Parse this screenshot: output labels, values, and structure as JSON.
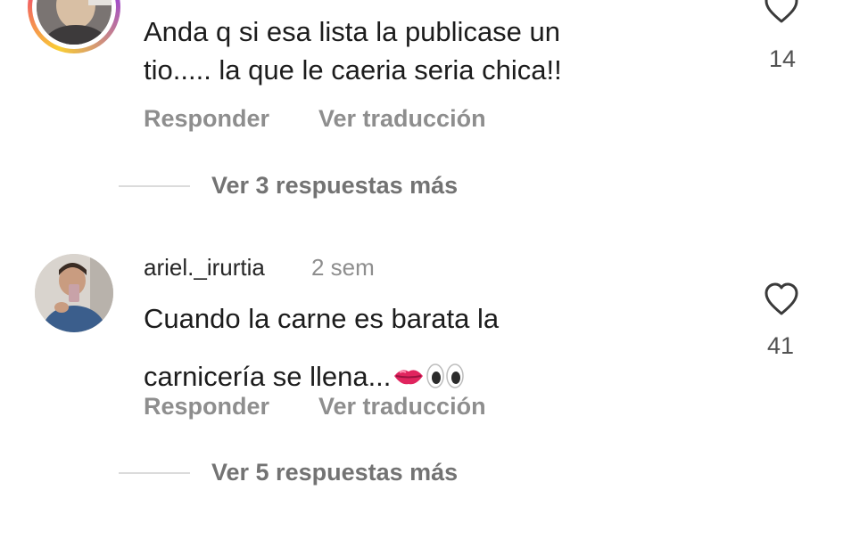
{
  "comments": [
    {
      "username": "",
      "timestamp": "",
      "text_line1": "Anda q si esa lista la publicase un",
      "text_line2": "tio..... la que le caeria seria chica!!",
      "likes": "14",
      "reply_label": "Responder",
      "translate_label": "Ver traducción",
      "replies_label": "Ver 3 respuestas más"
    },
    {
      "username": "ariel._irurtia",
      "timestamp": "2 sem",
      "text_line1": "Cuando la carne es barata la",
      "text_line2": "carnicería se llena...",
      "emojis": "👄👀",
      "likes": "41",
      "reply_label": "Responder",
      "translate_label": "Ver traducción",
      "replies_label": "Ver 5 respuestas más"
    }
  ],
  "icons": {
    "like": "heart-outline-icon"
  },
  "colors": {
    "text": "#1c1c1c",
    "secondary": "#8e8e8e",
    "divider": "#dbdbdb"
  }
}
